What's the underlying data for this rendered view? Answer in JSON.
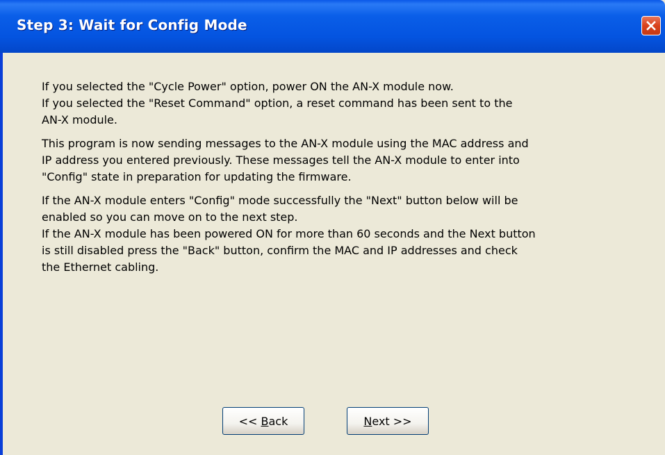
{
  "window": {
    "title": "Step 3: Wait for Config Mode",
    "close_icon": "close-icon"
  },
  "instructions": [
    {
      "lines": [
        "If you selected the \"Cycle Power\" option, power ON the AN-X module now.",
        "If you selected the \"Reset Command\" option, a reset command has been sent to the",
        "AN-X module."
      ]
    },
    {
      "lines": [
        "This program is now sending messages to the AN-X module using the MAC address and",
        "IP address you entered previously. These messages tell the AN-X module to enter into",
        "\"Config\" state in preparation for updating the firmware."
      ]
    },
    {
      "lines": [
        "If the AN-X module enters \"Config\" mode successfully the \"Next\" button below will be",
        "enabled so you can move on to the next step.",
        "If the AN-X module has been powered ON for more than 60 seconds and the Next button",
        "is still disabled press the \"Back\" button, confirm the MAC and IP addresses and check",
        "the Ethernet cabling."
      ]
    }
  ],
  "buttons": {
    "back": {
      "prefix": "<< ",
      "mnemonic": "B",
      "rest": "ack"
    },
    "next": {
      "prefix": "",
      "mnemonic": "N",
      "rest": "ext >>"
    }
  },
  "colors": {
    "titlebar": "#0454e0",
    "dialog_background": "#ece9d8",
    "close_button": "#d9411b"
  }
}
